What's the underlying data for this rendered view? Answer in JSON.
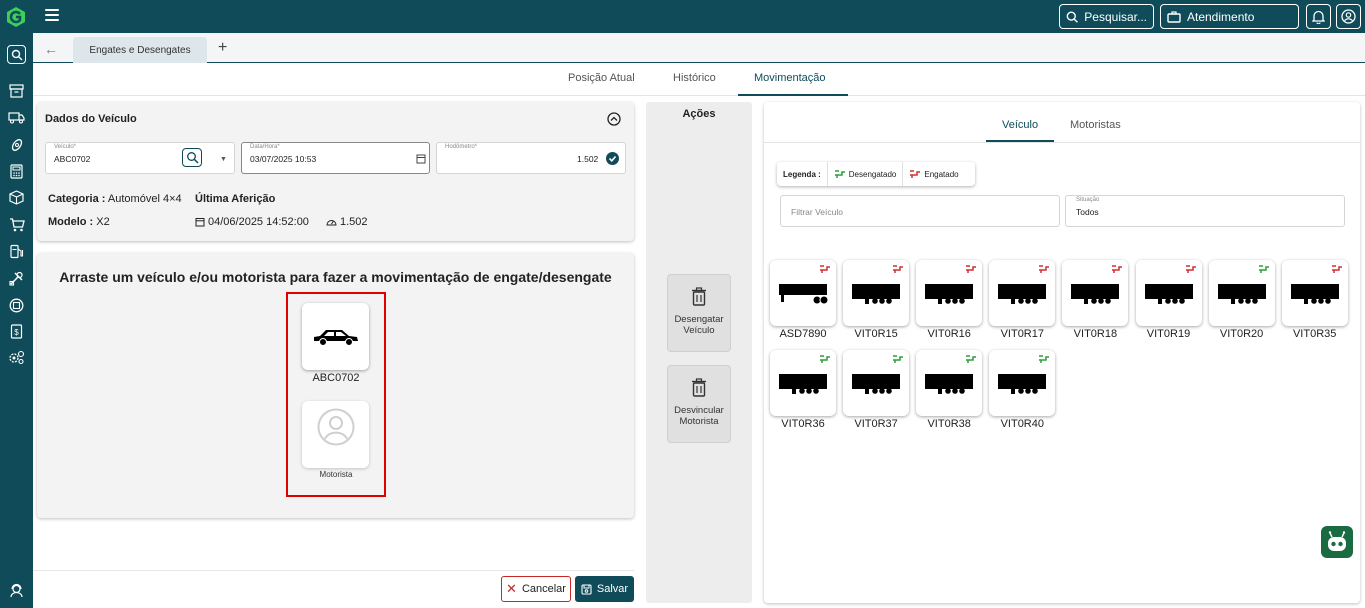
{
  "header": {
    "search_label": "Pesquisar...",
    "atendimento_label": "Atendimento"
  },
  "tabs": {
    "doc_tab_label": "Engates e Desengates",
    "add_tab": "+"
  },
  "subtabs": [
    "Posição Atual",
    "Histórico",
    "Movimentação"
  ],
  "dados": {
    "title": "Dados do Veículo",
    "veiculo_label": "Veículo*",
    "veiculo_value": "ABC0702",
    "data_label": "Data/Hora*",
    "data_value": "03/07/2025 10:53",
    "hodometro_label": "Hodômetro*",
    "hodometro_value": "1.502",
    "categoria_label": "Categoria :",
    "categoria_value": "Automóvel 4×4",
    "ultima_afericao_label": "Última Aferição",
    "modelo_label": "Modelo :",
    "modelo_value": "X2",
    "afericao_date": "04/06/2025 14:52:00",
    "afericao_value": "1.502"
  },
  "drag": {
    "instruction": "Arraste um veículo e/ou motorista para fazer a movimentação de engate/desengate",
    "vehicle_label": "ABC0702",
    "driver_label": "Motorista"
  },
  "acoes": {
    "title": "Ações",
    "desengatar_line1": "Desengatar",
    "desengatar_line2": "Veículo",
    "desvincular_line1": "Desvincular",
    "desvincular_line2": "Motorista"
  },
  "footer": {
    "cancel_label": "Cancelar",
    "save_label": "Salvar"
  },
  "right": {
    "tabs": [
      "Veículo",
      "Motoristas"
    ],
    "legend_title": "Legenda :",
    "legend_desengatado": "Desengatado",
    "legend_engatado": "Engatado",
    "filter_placeholder": "Filtrar Veículo",
    "situacao_label": "Situação",
    "situacao_value": "Todos",
    "vehicles": [
      {
        "label": "ASD7890",
        "status": "engatado"
      },
      {
        "label": "VIT0R15",
        "status": "engatado"
      },
      {
        "label": "VIT0R16",
        "status": "engatado"
      },
      {
        "label": "VIT0R17",
        "status": "engatado"
      },
      {
        "label": "VIT0R18",
        "status": "engatado"
      },
      {
        "label": "VIT0R19",
        "status": "engatado"
      },
      {
        "label": "VIT0R20",
        "status": "desengatado"
      },
      {
        "label": "VIT0R35",
        "status": "engatado"
      },
      {
        "label": "VIT0R36",
        "status": "desengatado"
      },
      {
        "label": "VIT0R37",
        "status": "desengatado"
      },
      {
        "label": "VIT0R38",
        "status": "desengatado"
      },
      {
        "label": "VIT0R40",
        "status": "desengatado"
      }
    ]
  },
  "colors": {
    "primary": "#0f4b59",
    "engatado": "#d32f2f",
    "desengatado": "#2e9e3a",
    "highlight": "#e00000"
  }
}
